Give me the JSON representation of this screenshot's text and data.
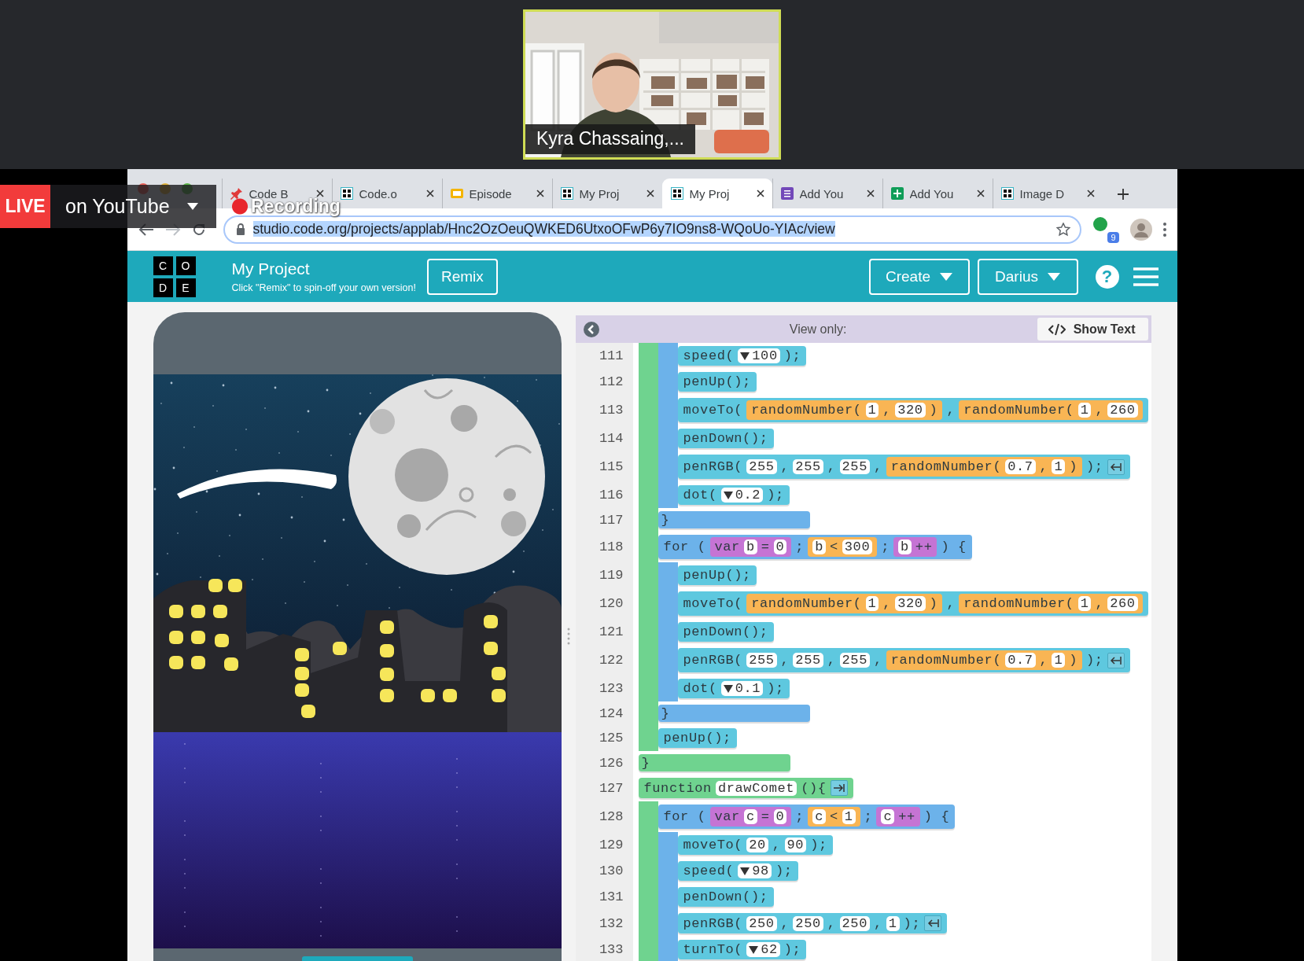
{
  "video_call": {
    "participant_name": "Kyra Chassaing,..."
  },
  "stream_overlay": {
    "live_badge": "LIVE",
    "platform": "on YouTube",
    "recording": "Recording"
  },
  "browser": {
    "tabs": [
      {
        "title": "Code B",
        "kind": "pin",
        "selected": false
      },
      {
        "title": "Code.o",
        "kind": "grid",
        "selected": false
      },
      {
        "title": "Episode",
        "kind": "slides",
        "selected": false
      },
      {
        "title": "My Proj",
        "kind": "grid",
        "selected": false
      },
      {
        "title": "My Proj",
        "kind": "grid",
        "selected": true
      },
      {
        "title": "Add You",
        "kind": "form",
        "selected": false
      },
      {
        "title": "Add You",
        "kind": "sheet",
        "selected": false
      },
      {
        "title": "Image D",
        "kind": "grid",
        "selected": false
      }
    ],
    "url": "studio.code.org/projects/applab/Hnc2OzOeuQWKED6UtxoOFwP6y7IO9ns8-WQoUo-YIAc/view",
    "url_selected": true,
    "extension_badge": "9"
  },
  "header": {
    "logo_letters": [
      "C",
      "O",
      "D",
      "E"
    ],
    "project_title": "My Project",
    "subtitle": "Click \"Remix\" to spin-off your own version!",
    "remix_button": "Remix",
    "menus": [
      "Create",
      "Darius"
    ],
    "help": "?"
  },
  "editor": {
    "status": "View only:",
    "show_text_button": "Show Text",
    "code": [
      {
        "kind": "function",
        "children": [
          {
            "kind": "for",
            "children": [
              {
                "kind": "statement",
                "num": "111",
                "parts": [
                  "speed(",
                  {
                    "kind": "slot",
                    "v": "100",
                    "dropdown": true
                  },
                  ");"
                ]
              },
              {
                "kind": "statement",
                "num": "112",
                "parts": [
                  "penUp();"
                ]
              },
              {
                "kind": "statement",
                "num": "113",
                "parts": [
                  "moveTo(",
                  {
                    "kind": "value",
                    "parts": [
                      "randomNumber(",
                      {
                        "kind": "slot",
                        "v": "1"
                      },
                      ",",
                      {
                        "kind": "slot",
                        "v": "320"
                      },
                      ")"
                    ]
                  },
                  ",",
                  {
                    "kind": "value",
                    "parts": [
                      "randomNumber(",
                      {
                        "kind": "slot",
                        "v": "1"
                      },
                      ",",
                      {
                        "kind": "slot",
                        "v": "260"
                      }
                    ]
                  }
                ]
              },
              {
                "kind": "statement",
                "num": "114",
                "parts": [
                  "penDown();"
                ]
              },
              {
                "kind": "statement",
                "num": "115",
                "parts": [
                  "penRGB(",
                  {
                    "kind": "slot",
                    "v": "255"
                  },
                  ",",
                  {
                    "kind": "slot",
                    "v": "255"
                  },
                  ",",
                  {
                    "kind": "slot",
                    "v": "255"
                  },
                  ",",
                  {
                    "kind": "value",
                    "parts": [
                      "randomNumber(",
                      {
                        "kind": "slot",
                        "v": "0.7"
                      },
                      ",",
                      {
                        "kind": "slot",
                        "v": "1"
                      },
                      ")"
                    ]
                  },
                  ");",
                  {
                    "kind": "arrow_left"
                  }
                ]
              },
              {
                "kind": "statement",
                "num": "116",
                "parts": [
                  "dot(",
                  {
                    "kind": "slot",
                    "v": "0.2",
                    "dropdown": true
                  },
                  ");"
                ]
              }
            ],
            "close": {
              "num": "117",
              "text": "}"
            }
          },
          {
            "kind": "for",
            "num": "118",
            "parts": [
              "for (",
              {
                "kind": "var",
                "parts": [
                  "var",
                  {
                    "kind": "slot",
                    "v": "b"
                  },
                  "=",
                  {
                    "kind": "slot",
                    "v": "0"
                  }
                ]
              },
              ";",
              {
                "kind": "value",
                "parts": [
                  {
                    "kind": "slot",
                    "v": "b"
                  },
                  "<",
                  {
                    "kind": "slot",
                    "v": "300"
                  }
                ]
              },
              ";",
              {
                "kind": "var",
                "parts": [
                  {
                    "kind": "slot",
                    "v": "b"
                  },
                  "++"
                ]
              },
              ") {"
            ],
            "children": [
              {
                "kind": "statement",
                "num": "119",
                "parts": [
                  "penUp();"
                ]
              },
              {
                "kind": "statement",
                "num": "120",
                "parts": [
                  "moveTo(",
                  {
                    "kind": "value",
                    "parts": [
                      "randomNumber(",
                      {
                        "kind": "slot",
                        "v": "1"
                      },
                      ",",
                      {
                        "kind": "slot",
                        "v": "320"
                      },
                      ")"
                    ]
                  },
                  ",",
                  {
                    "kind": "value",
                    "parts": [
                      "randomNumber(",
                      {
                        "kind": "slot",
                        "v": "1"
                      },
                      ",",
                      {
                        "kind": "slot",
                        "v": "260"
                      }
                    ]
                  }
                ]
              },
              {
                "kind": "statement",
                "num": "121",
                "parts": [
                  "penDown();"
                ]
              },
              {
                "kind": "statement",
                "num": "122",
                "parts": [
                  "penRGB(",
                  {
                    "kind": "slot",
                    "v": "255"
                  },
                  ",",
                  {
                    "kind": "slot",
                    "v": "255"
                  },
                  ",",
                  {
                    "kind": "slot",
                    "v": "255"
                  },
                  ",",
                  {
                    "kind": "value",
                    "parts": [
                      "randomNumber(",
                      {
                        "kind": "slot",
                        "v": "0.7"
                      },
                      ",",
                      {
                        "kind": "slot",
                        "v": "1"
                      },
                      ")"
                    ]
                  },
                  ");",
                  {
                    "kind": "arrow_left"
                  }
                ]
              },
              {
                "kind": "statement",
                "num": "123",
                "parts": [
                  "dot(",
                  {
                    "kind": "slot",
                    "v": "0.1",
                    "dropdown": true
                  },
                  ");"
                ]
              }
            ],
            "close": {
              "num": "124",
              "text": "}"
            }
          },
          {
            "kind": "statement",
            "num": "125",
            "parts": [
              "penUp();"
            ]
          }
        ],
        "close": {
          "num": "126",
          "text": "}"
        }
      },
      {
        "kind": "function",
        "num": "127",
        "parts": [
          "function",
          {
            "kind": "slot",
            "v": "drawComet"
          },
          "(){",
          {
            "kind": "arrow_right"
          }
        ],
        "children": [
          {
            "kind": "for",
            "num": "128",
            "parts": [
              "for (",
              {
                "kind": "var",
                "parts": [
                  "var",
                  {
                    "kind": "slot",
                    "v": "c"
                  },
                  "=",
                  {
                    "kind": "slot",
                    "v": "0"
                  }
                ]
              },
              ";",
              {
                "kind": "value",
                "parts": [
                  {
                    "kind": "slot",
                    "v": "c"
                  },
                  "<",
                  {
                    "kind": "slot",
                    "v": "1"
                  }
                ]
              },
              ";",
              {
                "kind": "var",
                "parts": [
                  {
                    "kind": "slot",
                    "v": "c"
                  },
                  "++"
                ]
              },
              ") {"
            ],
            "children": [
              {
                "kind": "statement",
                "num": "129",
                "parts": [
                  "moveTo(",
                  {
                    "kind": "slot",
                    "v": "20"
                  },
                  ",",
                  {
                    "kind": "slot",
                    "v": "90"
                  },
                  ");"
                ]
              },
              {
                "kind": "statement",
                "num": "130",
                "parts": [
                  "speed(",
                  {
                    "kind": "slot",
                    "v": "98",
                    "dropdown": true
                  },
                  ");"
                ]
              },
              {
                "kind": "statement",
                "num": "131",
                "parts": [
                  "penDown();"
                ]
              },
              {
                "kind": "statement",
                "num": "132",
                "parts": [
                  "penRGB(",
                  {
                    "kind": "slot",
                    "v": "250"
                  },
                  ",",
                  {
                    "kind": "slot",
                    "v": "250"
                  },
                  ",",
                  {
                    "kind": "slot",
                    "v": "250"
                  },
                  ",",
                  {
                    "kind": "slot",
                    "v": "1"
                  },
                  ");",
                  {
                    "kind": "arrow_left"
                  }
                ]
              },
              {
                "kind": "statement",
                "num": "133",
                "parts": [
                  "turnTo(",
                  {
                    "kind": "slot",
                    "v": "62",
                    "dropdown": true
                  },
                  ");"
                ]
              }
            ]
          }
        ]
      }
    ]
  }
}
